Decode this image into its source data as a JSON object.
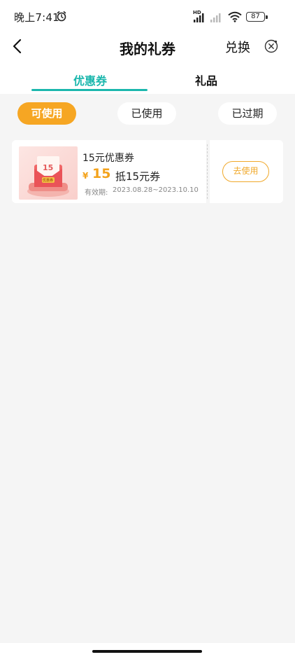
{
  "status_bar": {
    "time": "晚上7:41",
    "hd": "HD",
    "battery": "87"
  },
  "nav": {
    "title": "我的礼券",
    "redeem": "兑换"
  },
  "tabs": [
    {
      "label": "优惠券",
      "active": true
    },
    {
      "label": "礼品",
      "active": false
    }
  ],
  "filters": [
    {
      "label": "可使用",
      "active": true
    },
    {
      "label": "已使用",
      "active": false
    },
    {
      "label": "已过期",
      "active": false
    }
  ],
  "coupons": [
    {
      "name": "15元优惠券",
      "currency": "¥",
      "amount": "15",
      "desc": "抵15元券",
      "validity_label": "有效期:",
      "validity": "2023.08.28~2023.10.10",
      "action": "去使用",
      "image_text": "15",
      "image_badge": "优惠券"
    }
  ],
  "colors": {
    "accent_teal": "#1bb7ad",
    "accent_orange": "#f6a623",
    "background": "#f5f5f5"
  }
}
